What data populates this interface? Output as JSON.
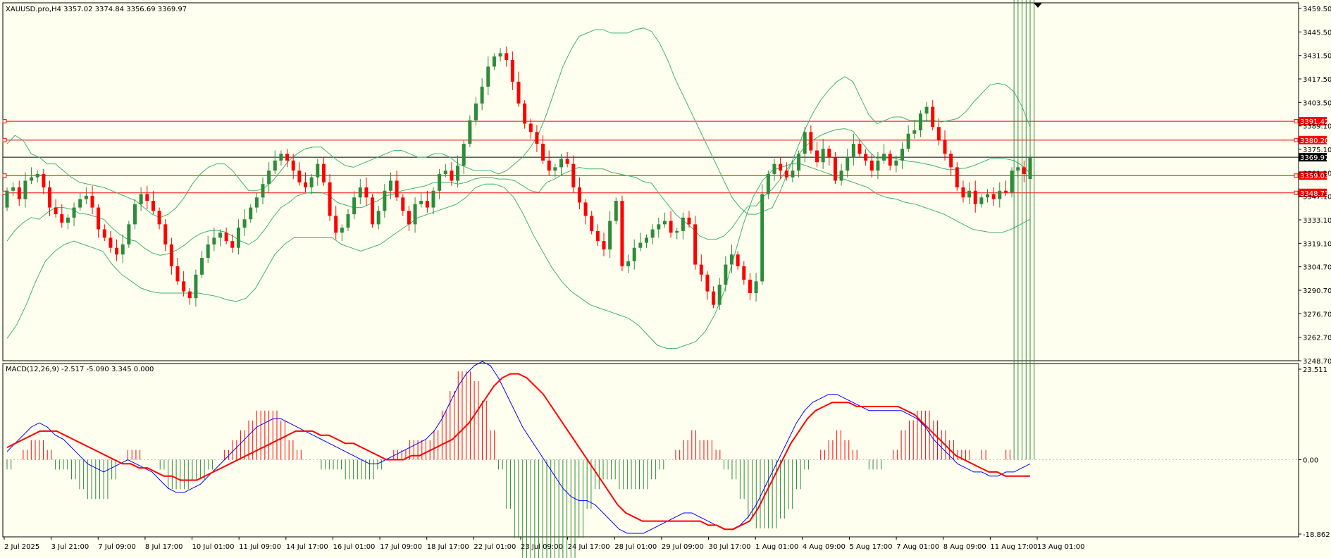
{
  "window": {
    "symbol_info": "XAUUSD.pro,H4  3357.02 3374.84 3356.69 3369.97",
    "macd_info": "MACD(12,26,9) -2.517 -5.090 3.345 0.000"
  },
  "colors": {
    "background": "#fffff0",
    "frame": "#000000",
    "bull_candle": "#2e8b3a",
    "bear_candle": "#ff0000",
    "bollinger": "#3cb371",
    "level_line": "#ff0000",
    "current_price_line": "#000000",
    "macd_line": "#0000ff",
    "signal_line": "#ff0000"
  },
  "price_axis": {
    "ticks": [
      "3459.50",
      "3445.50",
      "3431.50",
      "3417.50",
      "3403.50",
      "3389.10",
      "3375.10",
      "3361.10",
      "3347.10",
      "3333.10",
      "3319.10",
      "3304.70",
      "3290.70",
      "3276.70",
      "3262.70",
      "3248.70"
    ]
  },
  "price_labels": [
    {
      "text": "3391.42",
      "kind": "level",
      "value": 3391.42
    },
    {
      "text": "3380.20",
      "kind": "level",
      "value": 3380.2
    },
    {
      "text": "3369.97",
      "kind": "current",
      "value": 3369.97
    },
    {
      "text": "3359.03",
      "kind": "level",
      "value": 3359.03
    },
    {
      "text": "3348.73",
      "kind": "level",
      "value": 3348.73
    }
  ],
  "macd_axis": {
    "ticks": [
      {
        "text": "23.511",
        "value": 23.511
      },
      {
        "text": "0.00",
        "value": 0
      },
      {
        "text": "-18.862",
        "value": -18.862
      }
    ]
  },
  "time_axis": {
    "labels": [
      "2 Jul 2025",
      "3 Jul 21:00",
      "7 Jul 09:00",
      "8 Jul 17:00",
      "10 Jul 01:00",
      "11 Jul 09:00",
      "14 Jul 17:00",
      "16 Jul 01:00",
      "17 Jul 09:00",
      "18 Jul 17:00",
      "22 Jul 01:00",
      "23 Jul 09:00",
      "24 Jul 17:00",
      "28 Jul 01:00",
      "29 Jul 09:00",
      "30 Jul 17:00",
      "1 Aug 01:00",
      "4 Aug 09:00",
      "5 Aug 17:00",
      "7 Aug 01:00",
      "8 Aug 09:00",
      "11 Aug 17:00",
      "13 Aug 01:00"
    ]
  },
  "chart_data": {
    "type": "candlestick",
    "price_range": [
      3248.7,
      3462.0
    ],
    "macd_range": [
      -18.862,
      23.511
    ],
    "closes": [
      3350,
      3352,
      3345,
      3356,
      3358,
      3360,
      3352,
      3340,
      3336,
      3331,
      3334,
      3340,
      3345,
      3347,
      3340,
      3327,
      3322,
      3316,
      3312,
      3318,
      3330,
      3342,
      3348,
      3344,
      3338,
      3330,
      3318,
      3305,
      3296,
      3290,
      3286,
      3300,
      3310,
      3318,
      3322,
      3325,
      3320,
      3316,
      3328,
      3333,
      3340,
      3346,
      3354,
      3362,
      3368,
      3372,
      3368,
      3362,
      3355,
      3352,
      3358,
      3366,
      3355,
      3335,
      3325,
      3328,
      3336,
      3346,
      3352,
      3346,
      3330,
      3338,
      3350,
      3356,
      3346,
      3338,
      3330,
      3342,
      3344,
      3340,
      3350,
      3360,
      3362,
      3356,
      3365,
      3378,
      3392,
      3402,
      3412,
      3424,
      3430,
      3432,
      3428,
      3415,
      3402,
      3390,
      3385,
      3378,
      3368,
      3362,
      3364,
      3369,
      3366,
      3352,
      3343,
      3335,
      3326,
      3320,
      3315,
      3332,
      3344,
      3305,
      3308,
      3316,
      3319,
      3322,
      3327,
      3330,
      3332,
      3325,
      3326,
      3334,
      3330,
      3306,
      3300,
      3290,
      3282,
      3294,
      3306,
      3312,
      3305,
      3297,
      3289,
      3296,
      3348,
      3360,
      3366,
      3362,
      3358,
      3362,
      3372,
      3385,
      3374,
      3367,
      3375,
      3370,
      3356,
      3362,
      3370,
      3378,
      3372,
      3368,
      3362,
      3368,
      3372,
      3365,
      3368,
      3375,
      3384,
      3386,
      3396,
      3400,
      3388,
      3380,
      3372,
      3364,
      3352,
      3346,
      3350,
      3342,
      3346,
      3348,
      3345,
      3350,
      3349,
      3362,
      3364,
      3360,
      3370
    ],
    "opens": [
      3340,
      3350,
      3352,
      3345,
      3356,
      3358,
      3360,
      3352,
      3340,
      3336,
      3331,
      3334,
      3340,
      3345,
      3347,
      3340,
      3327,
      3322,
      3316,
      3312,
      3318,
      3330,
      3342,
      3348,
      3344,
      3338,
      3330,
      3318,
      3305,
      3296,
      3290,
      3286,
      3300,
      3310,
      3318,
      3322,
      3325,
      3320,
      3316,
      3328,
      3333,
      3340,
      3346,
      3354,
      3362,
      3368,
      3372,
      3368,
      3362,
      3355,
      3352,
      3358,
      3366,
      3355,
      3335,
      3325,
      3328,
      3336,
      3346,
      3352,
      3346,
      3330,
      3338,
      3350,
      3356,
      3346,
      3338,
      3330,
      3342,
      3344,
      3340,
      3350,
      3360,
      3362,
      3356,
      3365,
      3378,
      3392,
      3402,
      3412,
      3424,
      3430,
      3432,
      3428,
      3415,
      3402,
      3390,
      3385,
      3378,
      3368,
      3362,
      3364,
      3369,
      3366,
      3352,
      3343,
      3335,
      3326,
      3320,
      3315,
      3332,
      3344,
      3305,
      3308,
      3316,
      3319,
      3322,
      3327,
      3330,
      3332,
      3325,
      3326,
      3334,
      3330,
      3306,
      3300,
      3290,
      3282,
      3294,
      3306,
      3312,
      3305,
      3297,
      3289,
      3296,
      3348,
      3360,
      3366,
      3362,
      3358,
      3362,
      3372,
      3385,
      3374,
      3367,
      3375,
      3370,
      3356,
      3362,
      3370,
      3378,
      3372,
      3368,
      3362,
      3368,
      3372,
      3365,
      3368,
      3375,
      3384,
      3386,
      3396,
      3400,
      3388,
      3380,
      3372,
      3364,
      3352,
      3346,
      3350,
      3342,
      3346,
      3348,
      3345,
      3350,
      3349,
      3362,
      3364,
      3357
    ],
    "levels": [
      3391.42,
      3380.2,
      3359.03,
      3348.73
    ],
    "current_price": 3369.97,
    "bb_upper": [
      3378,
      3383,
      3380,
      3372,
      3370,
      3366,
      3366,
      3362,
      3358,
      3355,
      3354,
      3353,
      3352,
      3350,
      3348,
      3346,
      3344,
      3340,
      3336,
      3334,
      3336,
      3340,
      3346,
      3354,
      3360,
      3364,
      3366,
      3366,
      3362,
      3356,
      3350,
      3350,
      3352,
      3356,
      3362,
      3368,
      3372,
      3375,
      3376,
      3376,
      3372,
      3368,
      3365,
      3364,
      3366,
      3368,
      3370,
      3372,
      3374,
      3374,
      3372,
      3370,
      3370,
      3372,
      3372,
      3370,
      3366,
      3364,
      3362,
      3362,
      3362,
      3360,
      3362,
      3366,
      3370,
      3376,
      3384,
      3396,
      3410,
      3424,
      3434,
      3442,
      3444,
      3446,
      3446,
      3444,
      3444,
      3444,
      3446,
      3447,
      3445,
      3438,
      3428,
      3416,
      3406,
      3396,
      3386,
      3376,
      3366,
      3356,
      3346,
      3340,
      3336,
      3336,
      3338,
      3340,
      3350,
      3362,
      3374,
      3386,
      3396,
      3404,
      3410,
      3415,
      3418,
      3415,
      3405,
      3395,
      3390,
      3392,
      3394,
      3394,
      3392,
      3392,
      3392,
      3392,
      3391,
      3392,
      3393,
      3397,
      3403,
      3408,
      3413,
      3414,
      3413,
      3409,
      3400,
      3388
    ],
    "bb_lower": [
      3262,
      3270,
      3282,
      3296,
      3308,
      3314,
      3318,
      3320,
      3318,
      3316,
      3314,
      3306,
      3300,
      3296,
      3292,
      3290,
      3289,
      3289,
      3289,
      3289,
      3289,
      3288,
      3287,
      3285,
      3284,
      3286,
      3292,
      3302,
      3312,
      3318,
      3322,
      3322,
      3322,
      3322,
      3322,
      3318,
      3316,
      3314,
      3316,
      3318,
      3322,
      3326,
      3330,
      3334,
      3336,
      3338,
      3340,
      3342,
      3346,
      3352,
      3354,
      3354,
      3352,
      3346,
      3336,
      3324,
      3314,
      3304,
      3296,
      3290,
      3286,
      3282,
      3280,
      3278,
      3276,
      3274,
      3270,
      3264,
      3258,
      3256,
      3256,
      3258,
      3260,
      3266,
      3276,
      3290,
      3310,
      3330,
      3346,
      3356,
      3362,
      3364,
      3366,
      3366,
      3364,
      3362,
      3360,
      3358,
      3356,
      3354,
      3352,
      3348,
      3346,
      3345,
      3343,
      3342,
      3340,
      3338,
      3336,
      3333,
      3330,
      3327,
      3326,
      3325,
      3325,
      3327,
      3330,
      3333
    ],
    "macd_main": [
      2,
      4,
      6,
      8,
      9,
      8,
      6,
      5,
      3,
      1,
      -1,
      -2,
      -3,
      -2,
      -1,
      0,
      -1,
      -2,
      -3,
      -5,
      -7,
      -8,
      -8,
      -7,
      -6,
      -4,
      -2,
      0,
      2,
      4,
      6,
      8,
      9,
      10,
      10,
      9,
      8,
      7,
      6,
      5,
      4,
      3,
      2,
      1,
      0,
      -1,
      -1,
      0,
      1,
      2,
      3,
      4,
      5,
      7,
      10,
      14,
      18,
      21,
      23,
      24,
      23,
      20,
      16,
      12,
      8,
      5,
      2,
      -1,
      -4,
      -7,
      -9,
      -10,
      -10,
      -11,
      -13,
      -15,
      -17,
      -18,
      -18,
      -18,
      -17,
      -16,
      -15,
      -14,
      -13,
      -13,
      -14,
      -15,
      -16,
      -17,
      -17,
      -16,
      -14,
      -11,
      -7,
      -3,
      1,
      5,
      9,
      12,
      14,
      15,
      16,
      16,
      15,
      14,
      13,
      12,
      12,
      12,
      12,
      12,
      11,
      10,
      8,
      5,
      3,
      1,
      -1,
      -2,
      -3,
      -3,
      -4,
      -4,
      -3,
      -3,
      -2,
      -1
    ],
    "macd_signal": [
      3,
      4,
      5,
      6,
      7,
      7,
      7,
      6,
      5,
      4,
      3,
      2,
      1,
      0,
      -1,
      -1,
      -2,
      -2,
      -3,
      -4,
      -4,
      -5,
      -5,
      -5,
      -4,
      -3,
      -2,
      -1,
      0,
      1,
      2,
      3,
      4,
      5,
      6,
      7,
      7,
      7,
      6,
      6,
      5,
      4,
      4,
      3,
      2,
      1,
      0,
      0,
      0,
      1,
      1,
      2,
      3,
      4,
      5,
      7,
      9,
      12,
      15,
      18,
      20,
      21,
      21,
      20,
      18,
      16,
      13,
      10,
      7,
      4,
      1,
      -2,
      -5,
      -8,
      -11,
      -13,
      -14,
      -15,
      -15,
      -15,
      -15,
      -15,
      -15,
      -15,
      -15,
      -16,
      -16,
      -17,
      -17,
      -16,
      -15,
      -12,
      -8,
      -4,
      0,
      4,
      7,
      10,
      12,
      13,
      14,
      14,
      14,
      13,
      13,
      13,
      13,
      13,
      13,
      12,
      11,
      9,
      7,
      5,
      3,
      1,
      0,
      -1,
      -2,
      -3,
      -3,
      -4,
      -4,
      -4,
      -4
    ]
  }
}
